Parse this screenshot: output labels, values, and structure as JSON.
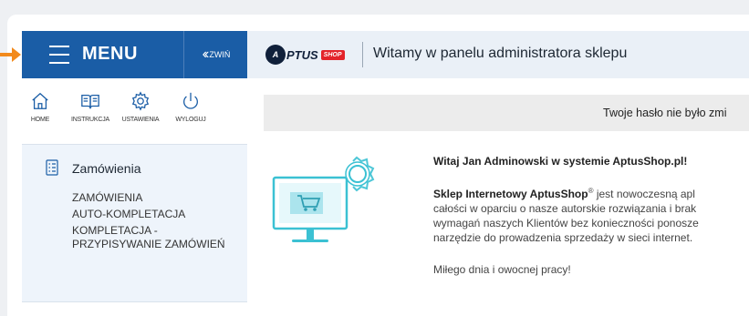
{
  "colors": {
    "accent_blue": "#1a5da6",
    "topbar_bg": "#eaf0f7",
    "arrow_orange": "#f28a1c",
    "illustration_cyan": "#3bc1d3"
  },
  "menu": {
    "title": "MENU",
    "collapse_label": "ZWIŃ",
    "icon": "hamburger-icon",
    "collapse_icon": "double-chevron-left-icon"
  },
  "header": {
    "logo": {
      "mark": "A",
      "text": "PTUS",
      "badge": "SHOP"
    },
    "title": "Witamy w panelu administratora sklepu"
  },
  "quick_nav": [
    {
      "label": "HOME",
      "icon": "home-icon"
    },
    {
      "label": "INSTRUKCJA",
      "icon": "book-icon"
    },
    {
      "label": "USTAWIENIA",
      "icon": "gear-icon"
    },
    {
      "label": "WYLOGUJ",
      "icon": "power-icon"
    }
  ],
  "sidebar": {
    "section_title": "Zamówienia",
    "section_icon": "list-icon",
    "items": [
      {
        "label": "ZAMÓWIENIA"
      },
      {
        "label": "AUTO-KOMPLETACJA"
      },
      {
        "label": "KOMPLETACJA - PRZYPISYWANIE ZAMÓWIEŃ"
      }
    ]
  },
  "notice": {
    "text": "Twoje hasło nie było zmi"
  },
  "content": {
    "greeting": "Witaj Jan Adminowski w systemie AptusShop.pl!",
    "para_bold": "Sklep Internetowy AptusShop",
    "para_reg": "®",
    "para_line1_rest": " jest nowoczesną apl",
    "para_line2": "całości w oparciu o nasze autorskie rozwiązania i brak",
    "para_line3": "wymagań naszych Klientów bez konieczności ponosze",
    "para_line4": "narzędzie do prowadzenia sprzedaży w sieci internet.",
    "farewell": "Miłego dnia i owocnej pracy!"
  }
}
